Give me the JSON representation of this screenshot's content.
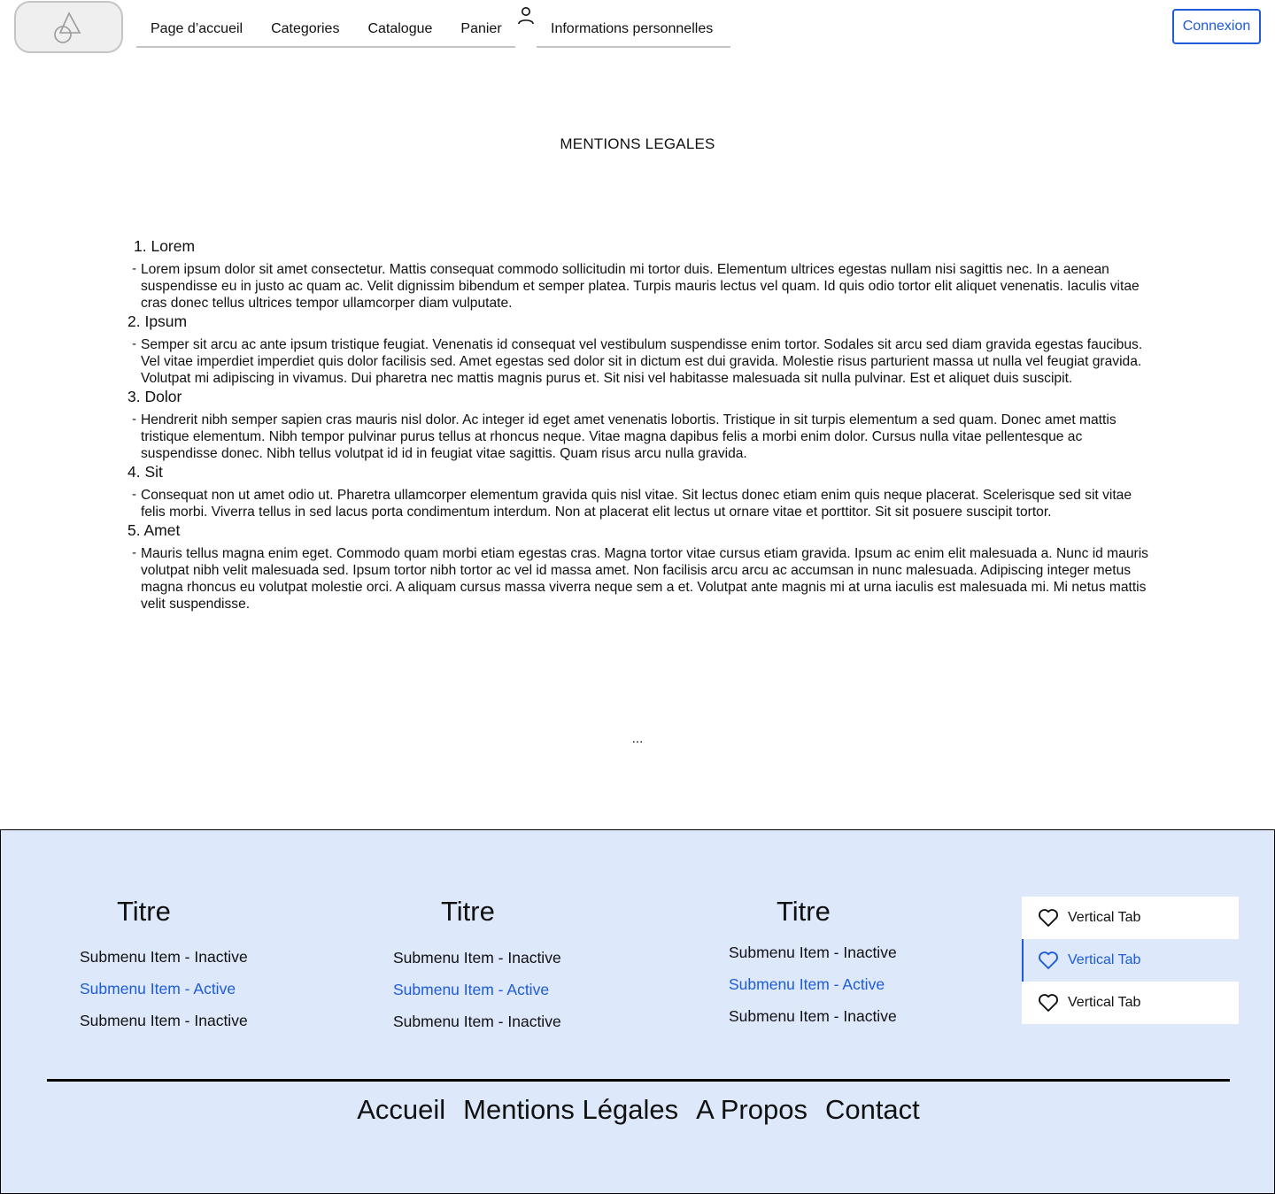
{
  "header": {
    "nav_main": [
      "Page d’accueil",
      "Categories",
      "Catalogue",
      "Panier"
    ],
    "nav_info": "Informations personnelles",
    "login_label": "Connexion"
  },
  "main": {
    "title": "MENTIONS LEGALES",
    "sections": [
      {
        "heading": "1. Lorem",
        "body": "Lorem ipsum dolor sit amet consectetur. Mattis consequat commodo sollicitudin mi tortor duis. Elementum ultrices egestas nullam nisi sagittis nec. In a aenean suspendisse eu in justo ac quam ac. Velit dignissim bibendum et semper platea. Turpis mauris lectus vel quam. Id quis odio tortor elit aliquet venenatis. Iaculis vitae cras donec tellus ultrices tempor ullamcorper diam vulputate."
      },
      {
        "heading": "2. Ipsum",
        "body": "Semper sit arcu ac ante ipsum tristique feugiat. Venenatis id consequat vel vestibulum suspendisse enim tortor. Sodales sit arcu sed diam gravida egestas faucibus. Vel vitae imperdiet imperdiet quis dolor facilisis sed. Amet egestas sed dolor sit in dictum est dui gravida. Molestie risus parturient massa ut nulla vel feugiat gravida. Volutpat mi adipiscing in vivamus. Dui pharetra nec mattis magnis purus et. Sit nisi vel habitasse malesuada sit nulla pulvinar. Est et aliquet duis suscipit."
      },
      {
        "heading": "3. Dolor",
        "body": "Hendrerit nibh semper sapien cras mauris nisl dolor. Ac integer id eget amet venenatis lobortis. Tristique in sit turpis elementum a sed quam. Donec amet mattis tristique elementum. Nibh tempor pulvinar purus tellus at rhoncus neque. Vitae magna dapibus felis a morbi enim dolor. Cursus nulla vitae pellentesque ac suspendisse donec. Nibh tellus volutpat id id in feugiat vitae sagittis. Quam risus arcu nulla gravida."
      },
      {
        "heading": "4. Sit",
        "body": "Consequat non ut amet odio ut. Pharetra ullamcorper elementum gravida quis nisl vitae. Sit lectus donec etiam enim quis neque placerat. Scelerisque sed sit vitae felis morbi. Viverra tellus in sed lacus porta condimentum interdum. Non at placerat elit lectus ut ornare vitae et porttitor. Sit sit posuere suscipit tortor."
      },
      {
        "heading": "5. Amet",
        "body": "Mauris tellus magna enim eget. Commodo quam morbi etiam egestas cras. Magna tortor vitae cursus etiam gravida. Ipsum ac enim elit malesuada a. Nunc id mauris volutpat nibh velit malesuada sed. Ipsum tortor nibh tortor ac vel id massa amet. Non facilisis arcu arcu ac accumsan in nunc malesuada. Adipiscing integer metus magna rhoncus eu volutpat molestie orci. A aliquam cursus massa viverra neque sem a et. Volutpat ante magnis mi at urna iaculis est malesuada mi. Mi netus mattis velit suspendisse."
      }
    ],
    "dash": "-",
    "ellipsis": "..."
  },
  "footer": {
    "columns": [
      {
        "title": "Titre",
        "items": [
          "Submenu Item - Inactive",
          "Submenu Item - Active",
          "Submenu Item - Inactive"
        ],
        "active_index": 1
      },
      {
        "title": "Titre",
        "items": [
          "Submenu Item - Inactive",
          "Submenu Item - Active",
          "Submenu Item - Inactive"
        ],
        "active_index": 1
      },
      {
        "title": "Titre",
        "items": [
          "Submenu Item - Inactive",
          "Submenu Item - Active",
          "Submenu Item - Inactive"
        ],
        "active_index": 1
      }
    ],
    "vertical_tabs": [
      {
        "label": "Vertical Tab",
        "icon": "heart-icon",
        "active": false
      },
      {
        "label": "Vertical Tab",
        "icon": "heart-icon",
        "active": true
      },
      {
        "label": "Vertical Tab",
        "icon": "heart-icon",
        "active": false
      }
    ],
    "links": [
      "Accueil",
      "Mentions Légales",
      "A Propos",
      "Contact"
    ]
  },
  "colors": {
    "accent": "#1e5bd6",
    "footer_bg": "#dde8fb",
    "border_gray": "#c4c4c4"
  }
}
